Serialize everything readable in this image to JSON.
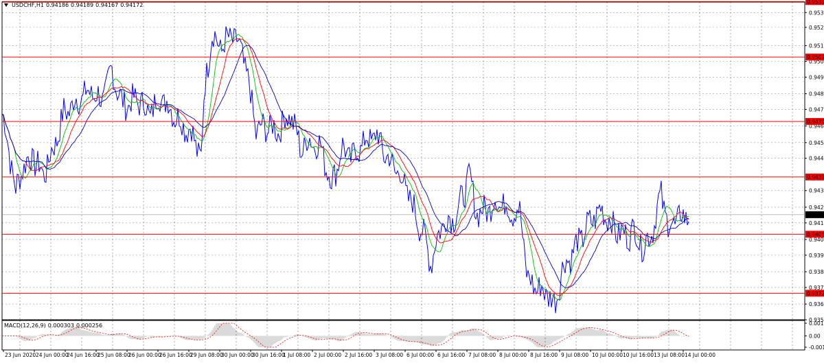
{
  "header": {
    "symbol": "USDCHF,H1",
    "open": "0.94186",
    "high": "0.94189",
    "low": "0.94167",
    "close": "0.94172"
  },
  "price_axis": {
    "labels": [
      "0.95330",
      "0.95245",
      "0.95140",
      "0.95050",
      "0.94960",
      "0.94865",
      "0.94775",
      "0.94680",
      "0.94585",
      "0.94495",
      "0.94310",
      "0.94215",
      "0.94125",
      "0.94030",
      "0.93940",
      "0.93845",
      "0.93755",
      "0.93660",
      "0.93570"
    ],
    "max": 0.9539,
    "min": 0.9357
  },
  "level_lines": [
    {
      "price": 0.95393,
      "label": "0.95393",
      "color": "#ff0000"
    },
    {
      "price": 0.95075,
      "label": "0.95075",
      "color": "#ff0000"
    },
    {
      "price": 0.94706,
      "label": "0.94706",
      "color": "#ff0000"
    },
    {
      "price": 0.94388,
      "label": "0.94388",
      "color": "#ff0000"
    },
    {
      "price": 0.9406,
      "label": "0.94060",
      "color": "#ff0000"
    },
    {
      "price": 0.93722,
      "label": "0.93722",
      "color": "#ff0000"
    }
  ],
  "current_price": {
    "price": 0.94172,
    "label": "0.94172"
  },
  "time_axis": {
    "labels": [
      "23 Jun 2020",
      "24 Jun 00:00",
      "24 Jun 16:00",
      "25 Jun 08:00",
      "26 Jun 00:00",
      "26 Jun 16:00",
      "29 Jun 08:00",
      "30 Jun 00:00",
      "30 Jun 16:00",
      "1 Jul 08:00",
      "2 Jul 00:00",
      "2 Jul 16:00",
      "3 Jul 08:00",
      "6 Jul 00:00",
      "6 Jul 16:00",
      "7 Jul 08:00",
      "8 Jul 00:00",
      "8 Jul 16:00",
      "9 Jul 08:00",
      "10 Jul 00:00",
      "10 Jul 16:00",
      "13 Jul 08:00",
      "14 Jul 00:00"
    ]
  },
  "macd": {
    "title": "MACD(12,26,9)",
    "main": "0.000303",
    "signal": "0.000256",
    "axis_labels": [
      "0.00121",
      "0.00",
      "-0.00108"
    ],
    "max": 0.00121,
    "min": -0.00108
  },
  "colors": {
    "price_line": "#0000ff",
    "ma_fast": "#00c000",
    "ma_mid": "#ff0000",
    "ma_slow": "#0000c8",
    "grid": "#c0c0c0",
    "level": "#ff0000",
    "macd_hist": "#b4b4b4",
    "macd_signal": "#ff0000"
  },
  "chart_data": {
    "type": "line",
    "title": "",
    "xlabel": "",
    "ylabel": "",
    "x": [
      "23 Jun 2020",
      "24 Jun 00:00",
      "24 Jun 16:00",
      "25 Jun 08:00",
      "26 Jun 00:00",
      "26 Jun 16:00",
      "29 Jun 08:00",
      "30 Jun 00:00",
      "30 Jun 16:00",
      "1 Jul 08:00",
      "2 Jul 00:00",
      "2 Jul 16:00",
      "3 Jul 08:00",
      "6 Jul 00:00",
      "6 Jul 16:00",
      "7 Jul 08:00",
      "8 Jul 00:00",
      "8 Jul 16:00",
      "9 Jul 08:00",
      "10 Jul 00:00",
      "10 Jul 16:00",
      "13 Jul 08:00",
      "14 Jul 00:00"
    ],
    "series": [
      {
        "name": "USDCHF,H1",
        "values": [
          0.947,
          0.9443,
          0.9463,
          0.9485,
          0.9482,
          0.9479,
          0.947,
          0.9521,
          0.9468,
          0.9463,
          0.945,
          0.9443,
          0.9458,
          0.9431,
          0.941,
          0.9422,
          0.9415,
          0.9378,
          0.937,
          0.9405,
          0.9418,
          0.941,
          0.9417
        ]
      }
    ],
    "ylim": [
      0.9357,
      0.9539
    ],
    "grid": true
  }
}
